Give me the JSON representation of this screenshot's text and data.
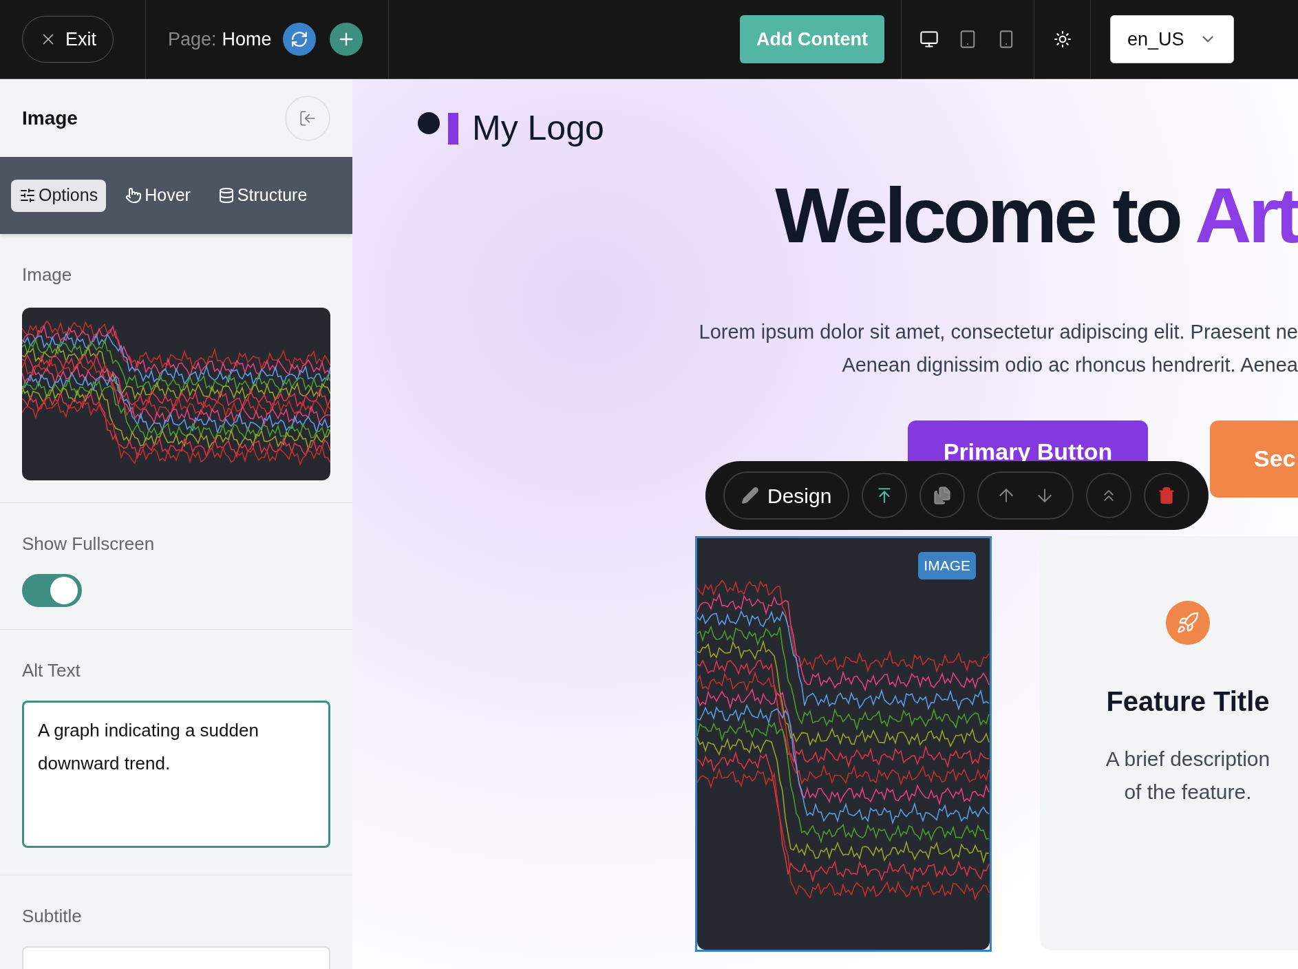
{
  "top_bar": {
    "exit_button": "Exit",
    "page_label": "Page:",
    "page_name": "Home",
    "add_content_button": "Add Content",
    "devices": [
      {
        "kind": "desktop",
        "selected": true
      },
      {
        "kind": "tablet",
        "selected": false
      },
      {
        "kind": "mobile",
        "selected": false
      }
    ],
    "locale_select": {
      "value": "en_US"
    }
  },
  "sidebar": {
    "title": "Image",
    "tabs": [
      {
        "label": "Options",
        "kind": "sliders",
        "selected": true
      },
      {
        "label": "Hover",
        "kind": "pointer",
        "selected": false
      },
      {
        "label": "Structure",
        "kind": "database",
        "selected": false
      }
    ],
    "image_label": "Image",
    "fullscreen": {
      "label": "Show Fullscreen",
      "on": true
    },
    "alt_text": {
      "label": "Alt Text",
      "value": "A graph indicating a sudden downward trend."
    },
    "subtitle": {
      "label": "Subtitle"
    }
  },
  "preview": {
    "logo": "My Logo",
    "headline": "Welcome to ",
    "headline_accent": "Art",
    "intro_lines": [
      "Lorem ipsum dolor sit amet, consectetur adipiscing elit. Praesent ne",
      "Aenean dignissim odio ac rhoncus hendrerit. Aenea"
    ],
    "buttons": [
      {
        "label": "Primary Button",
        "kind": "primary"
      },
      {
        "label": "Sec",
        "kind": "secondary"
      }
    ],
    "toolbar": {
      "design_button": "Design"
    },
    "image_block": {
      "badge": "IMAGE",
      "selected": true
    },
    "feature_card": {
      "title": "Feature Title",
      "description": "A brief description of the feature."
    }
  }
}
